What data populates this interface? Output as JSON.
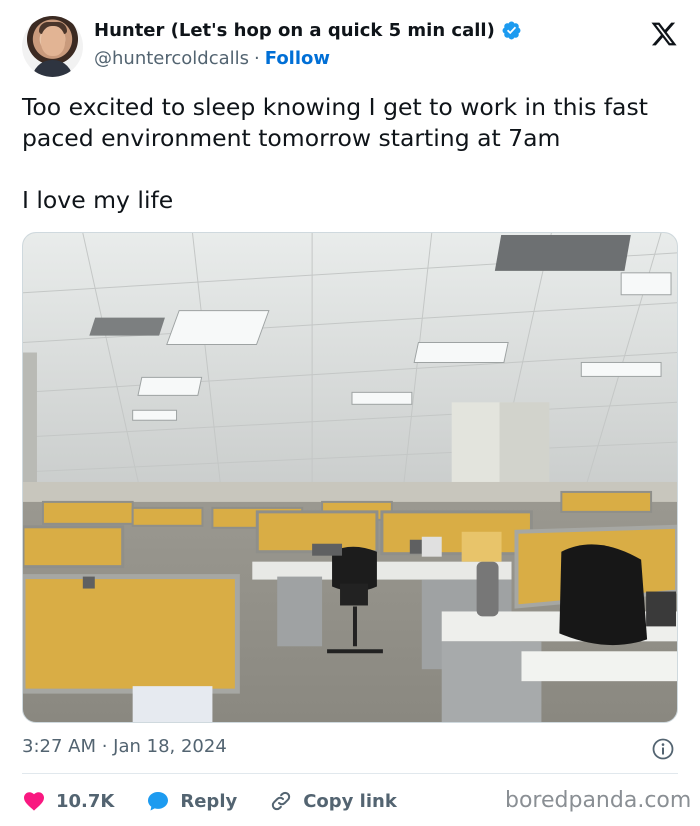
{
  "author": {
    "display_name": "Hunter (Let's hop on a quick 5 min call)",
    "handle": "@huntercoldcalls",
    "separator": "·",
    "follow_label": "Follow",
    "verified": true
  },
  "tweet": {
    "lines": [
      "Too excited to sleep knowing I get to work in this fast paced environment tomorrow starting at 7am",
      "I love my life"
    ],
    "timestamp": "3:27 AM · Jan 18, 2024"
  },
  "actions": {
    "like_count": "10.7K",
    "reply_label": "Reply",
    "copy_link_label": "Copy link"
  },
  "watermark": "boredpanda.com",
  "colors": {
    "accent": "#1d9bf0",
    "like": "#f91880",
    "muted_text": "#536471",
    "cubicle_panel": "#d9ad45"
  },
  "icons": {
    "brand": "x-logo-icon",
    "verified": "verified-badge-icon",
    "info": "info-icon",
    "like": "heart-icon",
    "reply": "reply-bubble-icon",
    "copy_link": "link-icon"
  }
}
